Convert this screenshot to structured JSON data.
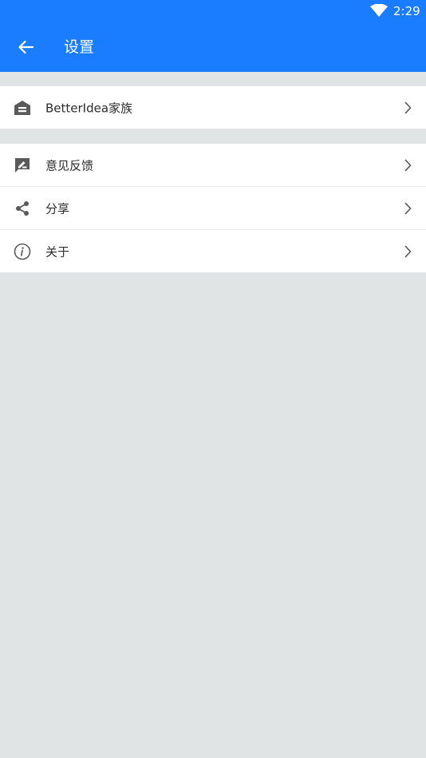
{
  "status_bar": {
    "time": "2:29",
    "wifi_icon": "wifi-icon"
  },
  "toolbar": {
    "back_icon": "arrow-back-icon",
    "title": "设置"
  },
  "settings_groups": [
    {
      "items": [
        {
          "label": "BetterIdea家族",
          "icon": "home-icon"
        }
      ]
    },
    {
      "items": [
        {
          "label": "意见反馈",
          "icon": "feedback-icon"
        },
        {
          "label": "分享",
          "icon": "share-icon"
        },
        {
          "label": "关于",
          "icon": "info-icon"
        }
      ]
    }
  ],
  "colors": {
    "app_bar": "#1a7cff",
    "background": "#e1e4e5",
    "row_background": "#ffffff",
    "icon": "#5a5a5a",
    "text": "#2b2b2b"
  }
}
